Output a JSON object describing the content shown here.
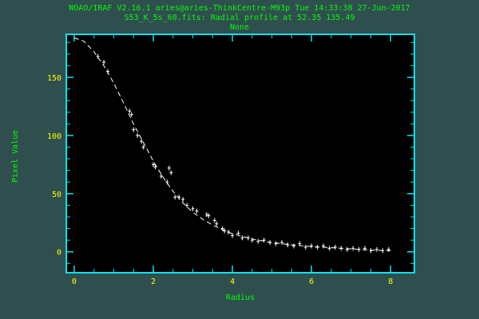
{
  "header": {
    "line1": "NOAO/IRAF V2.16.1 aries@aries-ThinkCentre-M93p Tue 14:33:38 27-Jun-2017",
    "line2": "S53_K_5s_60.fits: Radial profile at 52.35 135.49",
    "line3": "None"
  },
  "colors": {
    "background": "#2f4f4f",
    "plot_area": "#000000",
    "frame": "#00e5ee",
    "header_text": "#00ff00",
    "tick_labels": "#ffff00",
    "data_points": "#ffffff",
    "fit_curve": "#ffffff"
  },
  "chart_data": {
    "type": "scatter",
    "xlabel": "Radius",
    "ylabel": "Pixel Value",
    "xlim": [
      -0.2,
      8.6
    ],
    "ylim": [
      -18,
      187
    ],
    "x_ticks": [
      0,
      2,
      4,
      6,
      8
    ],
    "y_ticks": [
      0,
      50,
      100,
      150
    ],
    "grid": false,
    "points": [
      [
        0.6,
        168
      ],
      [
        0.75,
        163
      ],
      [
        0.85,
        155
      ],
      [
        1.4,
        121
      ],
      [
        1.45,
        118
      ],
      [
        1.5,
        105
      ],
      [
        1.6,
        100
      ],
      [
        1.7,
        95
      ],
      [
        1.75,
        90
      ],
      [
        2.0,
        75
      ],
      [
        2.05,
        73
      ],
      [
        2.2,
        65
      ],
      [
        2.35,
        60
      ],
      [
        2.4,
        72
      ],
      [
        2.45,
        68
      ],
      [
        2.55,
        47
      ],
      [
        2.65,
        47
      ],
      [
        2.75,
        45
      ],
      [
        2.85,
        40
      ],
      [
        3.0,
        37
      ],
      [
        3.1,
        35
      ],
      [
        3.35,
        32
      ],
      [
        3.4,
        31
      ],
      [
        3.55,
        27
      ],
      [
        3.6,
        24
      ],
      [
        3.75,
        20
      ],
      [
        3.8,
        18
      ],
      [
        3.9,
        17
      ],
      [
        4.0,
        14
      ],
      [
        4.15,
        16
      ],
      [
        4.25,
        12
      ],
      [
        4.4,
        12
      ],
      [
        4.5,
        10
      ],
      [
        4.65,
        9
      ],
      [
        4.8,
        10
      ],
      [
        4.95,
        8
      ],
      [
        5.1,
        7
      ],
      [
        5.25,
        8
      ],
      [
        5.4,
        6
      ],
      [
        5.55,
        5
      ],
      [
        5.7,
        7
      ],
      [
        5.85,
        4
      ],
      [
        6.0,
        5
      ],
      [
        6.15,
        4
      ],
      [
        6.3,
        5
      ],
      [
        6.45,
        3
      ],
      [
        6.6,
        4
      ],
      [
        6.75,
        3
      ],
      [
        6.9,
        2
      ],
      [
        7.05,
        3
      ],
      [
        7.2,
        2
      ],
      [
        7.35,
        3
      ],
      [
        7.5,
        1
      ],
      [
        7.65,
        2
      ],
      [
        7.8,
        1
      ],
      [
        7.95,
        2
      ]
    ],
    "fit_curve": [
      [
        0.0,
        184
      ],
      [
        0.25,
        181
      ],
      [
        0.5,
        172
      ],
      [
        0.75,
        160
      ],
      [
        1.0,
        145
      ],
      [
        1.25,
        128
      ],
      [
        1.5,
        110
      ],
      [
        1.75,
        94
      ],
      [
        2.0,
        78
      ],
      [
        2.25,
        64
      ],
      [
        2.5,
        52
      ],
      [
        2.75,
        42
      ],
      [
        3.0,
        34
      ],
      [
        3.25,
        28
      ],
      [
        3.5,
        23
      ],
      [
        3.75,
        19
      ],
      [
        4.0,
        15.5
      ],
      [
        4.5,
        11
      ],
      [
        5.0,
        8
      ],
      [
        5.5,
        6
      ],
      [
        6.0,
        4.5
      ],
      [
        6.5,
        3.5
      ],
      [
        7.0,
        2.5
      ],
      [
        7.5,
        1.5
      ],
      [
        8.0,
        1
      ]
    ]
  }
}
